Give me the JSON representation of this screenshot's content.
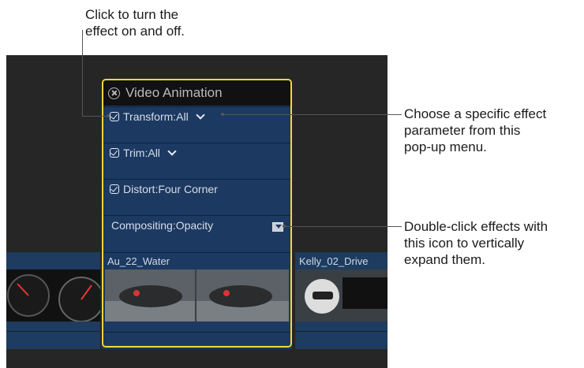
{
  "callouts": {
    "checkbox": "Click to turn the\neffect on and off.",
    "popup": "Choose a specific effect\nparameter from this\npop-up menu.",
    "expand": "Double-click effects with\nthis icon to vertically\nexpand them."
  },
  "animation_editor": {
    "title": "Video Animation",
    "rows": [
      {
        "label": "Transform:All",
        "checked": true,
        "has_menu": true
      },
      {
        "label": "Trim:All",
        "checked": true,
        "has_menu": true
      },
      {
        "label": "Distort:Four Corner",
        "checked": true,
        "has_menu": false
      },
      {
        "label": "Compositing:Opacity",
        "checked": false,
        "has_menu": false,
        "has_expand_icon": true
      }
    ]
  },
  "clips": [
    {
      "name": "Au_22_Water"
    },
    {
      "name": "Kelly_02_Drive"
    }
  ],
  "colors": {
    "highlight_border": "#f3d63a",
    "panel_blue": "#1c3961",
    "timeline_bg": "#262626"
  }
}
